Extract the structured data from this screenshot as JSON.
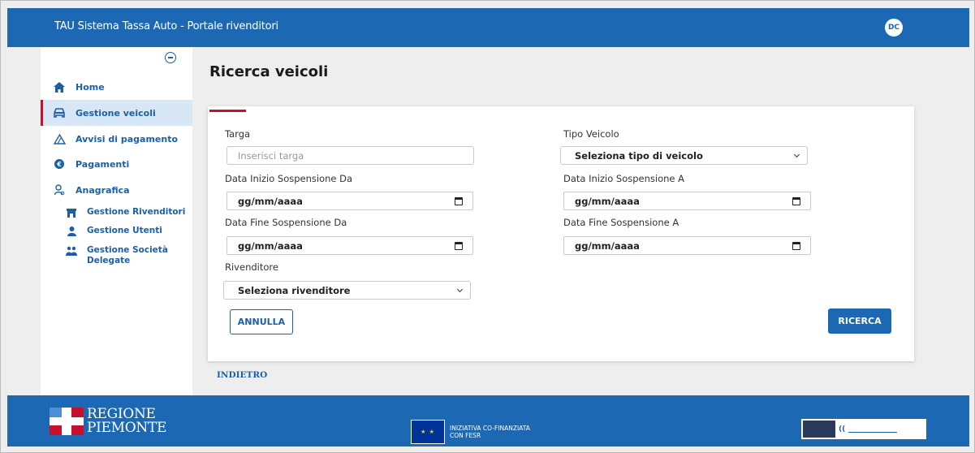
{
  "header": {
    "app_title": "TAU Sistema Tassa Auto - Portale rivenditori",
    "user_initials": "DC"
  },
  "sidebar": {
    "items": [
      {
        "label": "Home",
        "icon": "home-icon"
      },
      {
        "label": "Gestione veicoli",
        "icon": "car-icon",
        "active": true
      },
      {
        "label": "Avvisi di pagamento",
        "icon": "warning-icon"
      },
      {
        "label": "Pagamenti",
        "icon": "euro-icon"
      },
      {
        "label": "Anagrafica",
        "icon": "user-search-icon"
      }
    ],
    "subitems": [
      {
        "label": "Gestione Rivenditori",
        "icon": "shop-icon"
      },
      {
        "label": "Gestione Utenti",
        "icon": "user-icon"
      },
      {
        "label": "Gestione Società Delegate",
        "icon": "users-icon"
      }
    ]
  },
  "page": {
    "title": "Ricerca veicoli",
    "back_label": "INDIETRO"
  },
  "form": {
    "targa_label": "Targa",
    "targa_placeholder": "Inserisci targa",
    "tipo_label": "Tipo Veicolo",
    "tipo_value": "Seleziona tipo di veicolo",
    "inizio_da_label": "Data Inizio Sospensione Da",
    "inizio_da_value": "gg/mm/aaaa",
    "inizio_a_label": "Data Inizio Sospensione A",
    "inizio_a_value": "gg/mm/aaaa",
    "fine_da_label": "Data Fine Sospensione Da",
    "fine_da_value": "gg/mm/aaaa",
    "fine_a_label": "Data Fine Sospensione A",
    "fine_a_value": "gg/mm/aaaa",
    "rivenditore_label": "Rivenditore",
    "rivenditore_value": "Seleziona rivenditore",
    "cancel_label": "ANNULLA",
    "search_label": "RICERCA"
  },
  "footer": {
    "regione_line1": "REGIONE",
    "regione_line2": "PIEMONTE",
    "eu_line1": "INIZIATIVA CO-FINANZIATA",
    "eu_line2": "CON FESR"
  },
  "colors": {
    "brand_blue": "#1d68b3",
    "accent_red": "#c8102e"
  }
}
